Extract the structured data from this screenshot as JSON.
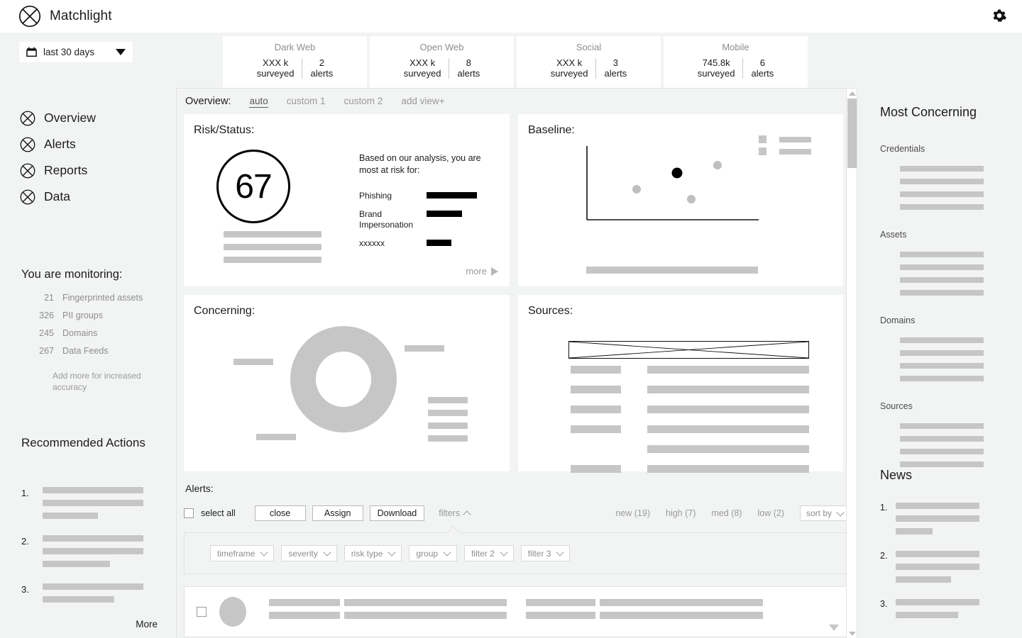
{
  "app": {
    "brand": "Matchlight",
    "logo_icon": "circle-x-logo",
    "settings_icon": "gear-icon"
  },
  "datepicker": {
    "icon": "calendar-icon",
    "value": "last 30 days",
    "caret_icon": "chevron-down-icon"
  },
  "stat_cards": [
    {
      "title": "Dark Web",
      "surveyed_value": "XXX k",
      "surveyed_label": "surveyed",
      "alerts_value": "2",
      "alerts_label": "alerts"
    },
    {
      "title": "Open Web",
      "surveyed_value": "XXX k",
      "surveyed_label": "surveyed",
      "alerts_value": "8",
      "alerts_label": "alerts"
    },
    {
      "title": "Social",
      "surveyed_value": "XXX k",
      "surveyed_label": "surveyed",
      "alerts_value": "3",
      "alerts_label": "alerts"
    },
    {
      "title": "Mobile",
      "surveyed_value": "745.8k",
      "surveyed_label": "surveyed",
      "alerts_value": "6",
      "alerts_label": "alerts"
    }
  ],
  "sidebar": {
    "nav": [
      {
        "label": "Overview",
        "icon": "circle-x-icon"
      },
      {
        "label": "Alerts",
        "icon": "circle-x-icon"
      },
      {
        "label": "Reports",
        "icon": "circle-x-icon"
      },
      {
        "label": "Data",
        "icon": "circle-x-icon"
      }
    ],
    "monitoring": {
      "title": "You are monitoring:",
      "rows": [
        {
          "count": "21",
          "label": "Fingerprinted assets"
        },
        {
          "count": "326",
          "label": "PII groups"
        },
        {
          "count": "245",
          "label": "Domains"
        },
        {
          "count": "267",
          "label": "Data Feeds"
        }
      ],
      "note": "Add more for increased accuracy"
    },
    "recommended": {
      "title": "Recommended Actions",
      "items": [
        {
          "num": "1.",
          "line_widths": [
            142,
            142,
            78
          ]
        },
        {
          "num": "2.",
          "line_widths": [
            142,
            142,
            95
          ]
        },
        {
          "num": "3.",
          "line_widths": [
            142,
            101
          ]
        }
      ],
      "more_label": "More"
    }
  },
  "overview": {
    "label": "Overview:",
    "tabs": [
      {
        "label": "auto",
        "active": true
      },
      {
        "label": "custom 1",
        "active": false
      },
      {
        "label": "custom 2",
        "active": false
      },
      {
        "label": "add view+",
        "active": false
      }
    ]
  },
  "risk_card": {
    "title": "Risk/Status:",
    "score": "67",
    "lead": "Based on our analysis, you are most at risk for:",
    "more_label": "more",
    "more_icon": "play-triangle-icon",
    "skeleton_widths": [
      138,
      138,
      138
    ]
  },
  "baseline_card": {
    "title": "Baseline:",
    "legend_rows": 2
  },
  "concerning_card": {
    "title": "Concerning:"
  },
  "sources_card": {
    "title": "Sources:"
  },
  "alerts": {
    "title": "Alerts:",
    "select_all_label": "select all",
    "buttons": [
      {
        "label": "close"
      },
      {
        "label": "Assign"
      },
      {
        "label": "Download"
      }
    ],
    "filters_label": "filters",
    "filters_icon": "chevron-up-icon",
    "severity_counts": [
      {
        "label": "new (19)"
      },
      {
        "label": "high  (7)"
      },
      {
        "label": "med  (8)"
      },
      {
        "label": "low  (2)"
      }
    ],
    "sort_by_label": "sort by",
    "sort_by_icon": "chevron-down-icon",
    "filter_chips": [
      {
        "label": "timeframe"
      },
      {
        "label": "severity"
      },
      {
        "label": "risk type"
      },
      {
        "label": "group"
      },
      {
        "label": "filter 2"
      },
      {
        "label": "filter 3"
      }
    ],
    "row": {
      "avatar_icon": "avatar-placeholder",
      "expand_icon": "caret-down-icon"
    }
  },
  "scrollbar": {
    "up_icon": "scroll-up-arrow-icon",
    "down_icon": "scroll-down-arrow-icon"
  },
  "rail": {
    "title": "Most Concerning",
    "groups": [
      {
        "label": "Credentials"
      },
      {
        "label": "Assets"
      },
      {
        "label": "Domains"
      },
      {
        "label": "Sources"
      }
    ]
  },
  "news": {
    "title": "News",
    "items": [
      {
        "num": "1.",
        "line_widths": [
          118,
          118,
          52
        ]
      },
      {
        "num": "2.",
        "line_widths": [
          118,
          118,
          78
        ]
      },
      {
        "num": "3.",
        "line_widths": [
          118,
          88
        ]
      }
    ]
  },
  "chart_data": [
    {
      "type": "bar",
      "title": "Based on our analysis, you are most at risk for:",
      "categories": [
        "Phishing",
        "Brand Impersonation",
        "xxxxxx"
      ],
      "values": [
        100,
        66,
        40
      ],
      "xlabel": "",
      "ylabel": "",
      "ylim": [
        0,
        100
      ],
      "grid": false,
      "legend": "none",
      "orientation": "horizontal",
      "bar_color": "#000000"
    },
    {
      "type": "scatter",
      "title": "Baseline:",
      "xlabel": "",
      "ylabel": "",
      "xlim": [
        0,
        100
      ],
      "ylim": [
        0,
        100
      ],
      "grid": false,
      "legend": "top-right",
      "series": [
        {
          "name": "baseline",
          "color": "#bfbfbf",
          "points": [
            [
              29,
              43
            ],
            [
              62,
              25
            ],
            [
              77,
              74
            ]
          ]
        },
        {
          "name": "you",
          "color": "#000000",
          "points": [
            [
              53,
              63
            ]
          ]
        }
      ]
    },
    {
      "type": "pie",
      "title": "Concerning:",
      "labels": [
        "segment-1",
        "segment-2",
        "segment-3",
        "segment-4"
      ],
      "values": [
        25,
        25,
        25,
        25
      ],
      "donut": true,
      "colors": [
        "#c6c6c6",
        "#c6c6c6",
        "#c6c6c6",
        "#c6c6c6"
      ],
      "legend": "left-and-right"
    },
    {
      "type": "table",
      "title": "Sources:",
      "columns": 2,
      "rows": 6
    }
  ]
}
